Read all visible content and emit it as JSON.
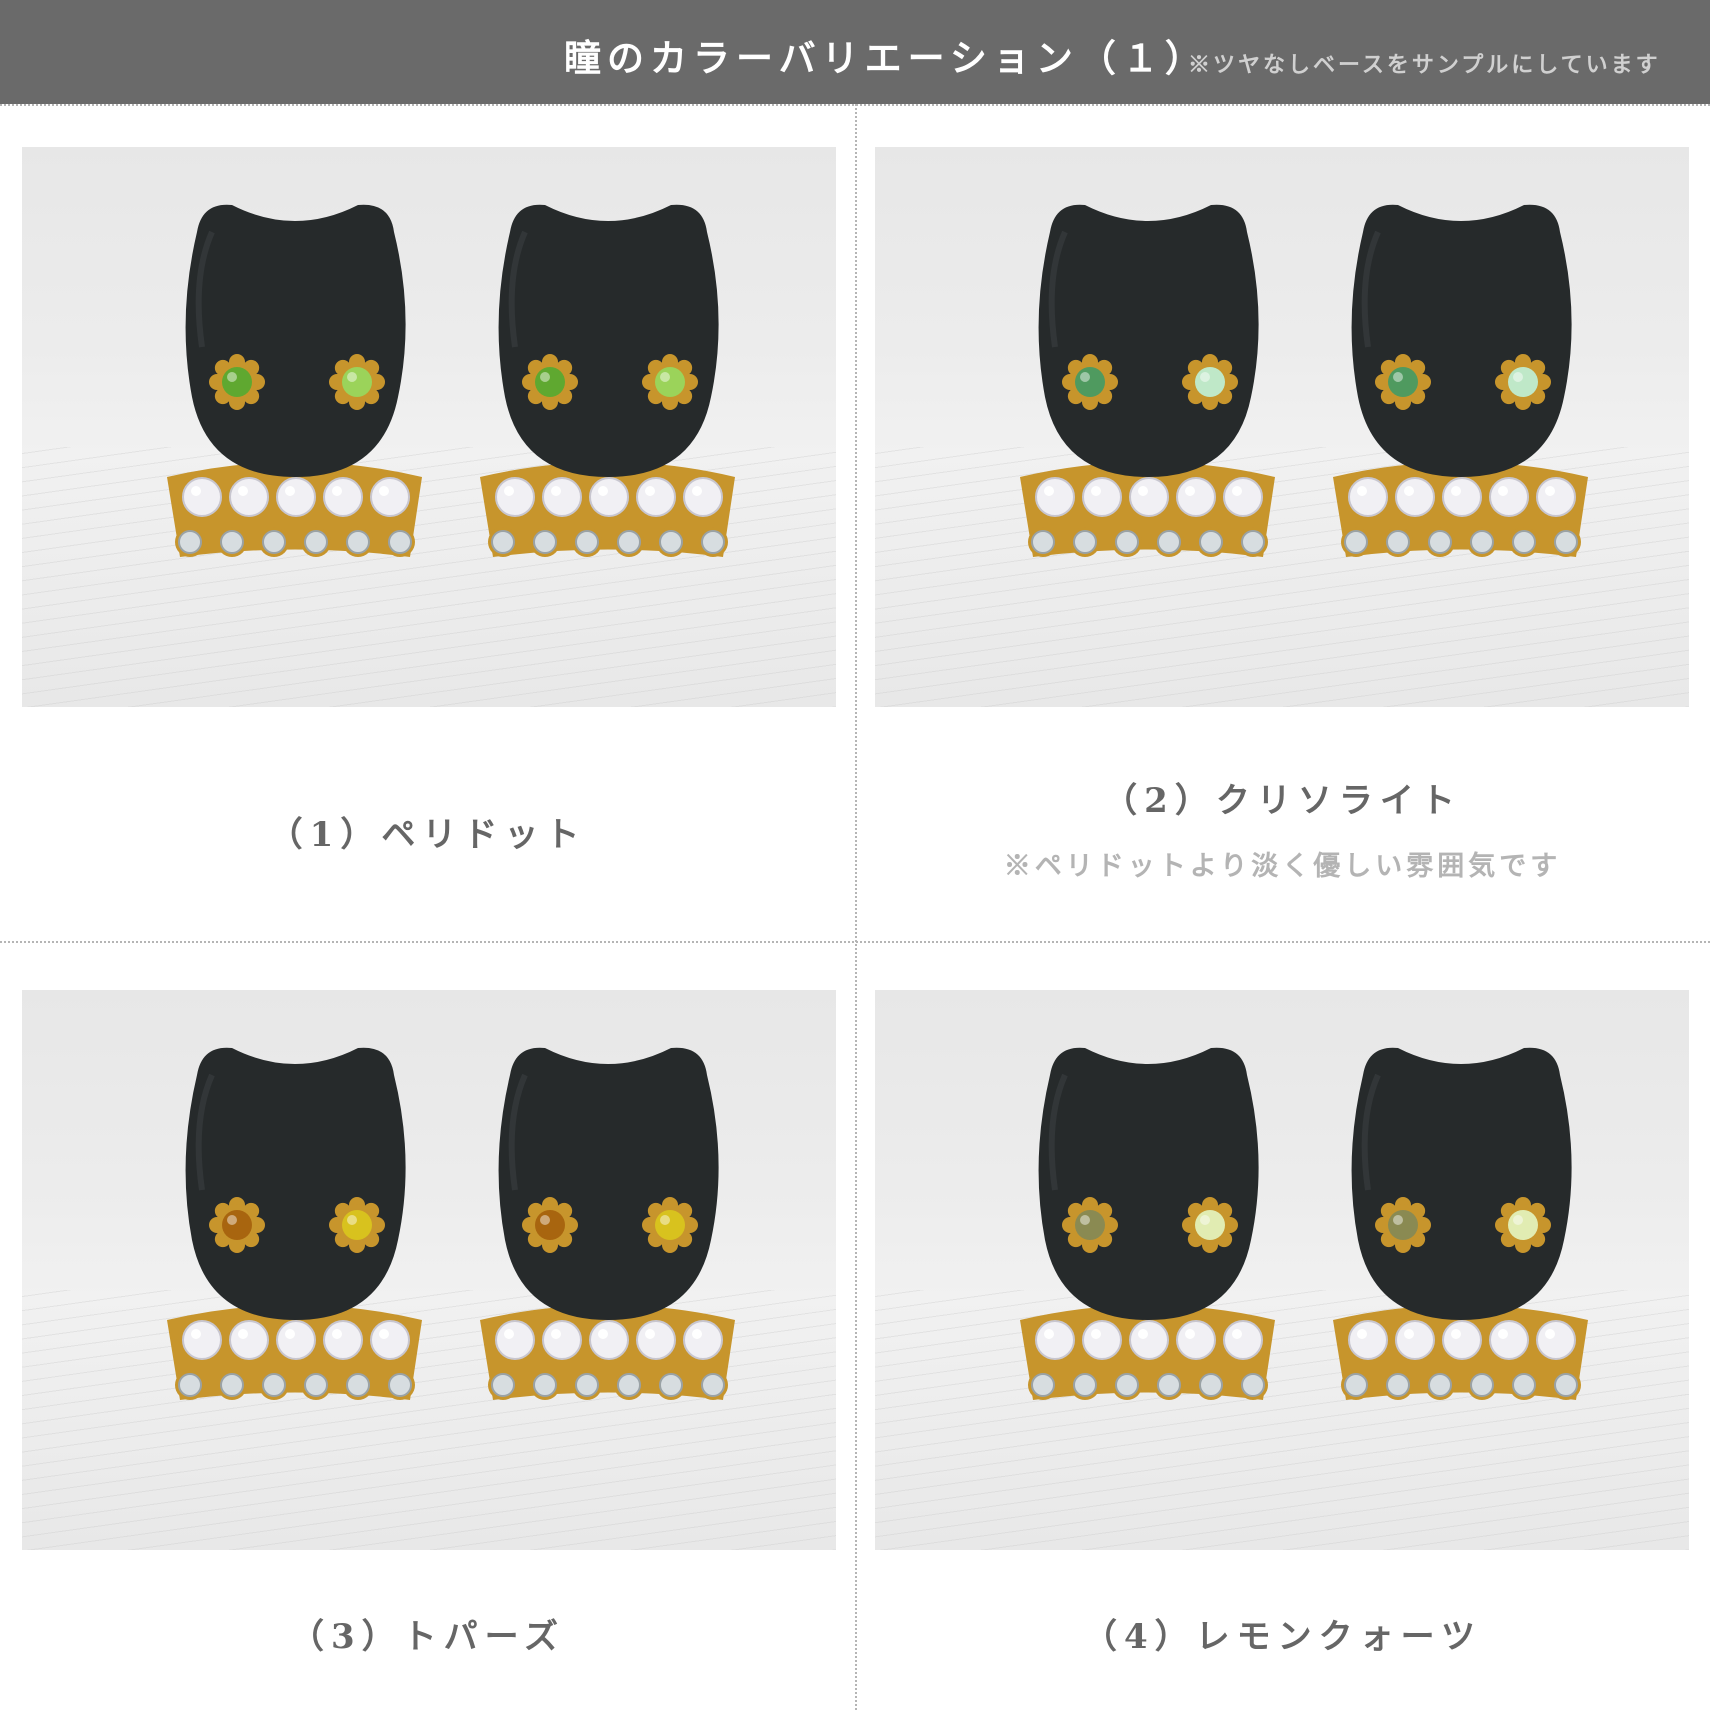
{
  "header": {
    "title": "瞳のカラーバリエーション（１）",
    "note": "※ツヤなしベースをサンプルにしています",
    "background": "#6a6a6a"
  },
  "variants": [
    {
      "label": "（1）ペリドット",
      "eye_colors": [
        "#5fa830",
        "#9bd35a"
      ]
    },
    {
      "label": "（2）クリソライト",
      "note": "※ペリドットより淡く優しい雰囲気です",
      "eye_colors": [
        "#4f9a5f",
        "#bfe8c8"
      ]
    },
    {
      "label": "（3）トパーズ",
      "eye_colors": [
        "#a8650f",
        "#d8c21e"
      ]
    },
    {
      "label": "（4）レモンクォーツ",
      "eye_colors": [
        "#8a8a52",
        "#e1ecb2"
      ]
    }
  ],
  "colors": {
    "cat_body": "#262a2b",
    "gold": "#c7952c",
    "pearl": "#f1f0f4",
    "crystal": "#d7dde0",
    "caption_text": "#666666",
    "note_text": "#b4b4b4"
  }
}
